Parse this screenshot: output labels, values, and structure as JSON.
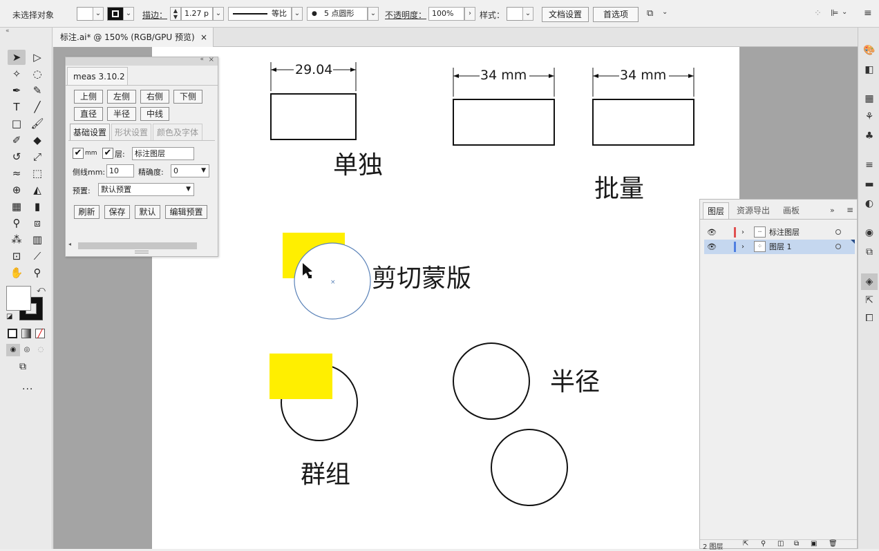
{
  "control_bar": {
    "selection_status": "未选择对象",
    "stroke_label": "描边：",
    "stroke_width": "1.27 p",
    "profile_label": "等比",
    "brush_dot": "●",
    "brush_label": "5 点圆形",
    "opacity_label": "不透明度：",
    "opacity_value": "100%",
    "style_label": "样式：",
    "doc_setup_button": "文档设置",
    "preferences_button": "首选项"
  },
  "document_tab": {
    "title": "标注.ai* @ 150% (RGB/GPU 预览)",
    "close": "×"
  },
  "artboard": {
    "dim_single": "29.04",
    "dim_batch_1": "34 mm",
    "dim_batch_2": "34 mm",
    "label_single": "单独",
    "label_batch": "批量",
    "label_clip": "剪切蒙版",
    "label_radius": "半径",
    "label_group": "群组",
    "highlight_color": "#ffef00"
  },
  "meas_panel": {
    "title": "meas 3.10.2",
    "buttons_row1": [
      "上侧",
      "左侧",
      "右侧",
      "下侧"
    ],
    "buttons_row2": [
      "直径",
      "半径",
      "中线"
    ],
    "tabs": [
      "基础设置",
      "形状设置",
      "颜色及字体"
    ],
    "mm_label": "mm",
    "layer_label": "层:",
    "layer_value": "标注图层",
    "side_line_label": "侧线mm:",
    "side_line_value": "10",
    "precision_label": "精确度:",
    "precision_value": "0",
    "preset_label": "预置:",
    "preset_value": "默认预置",
    "bottom_buttons": [
      "刷新",
      "保存",
      "默认",
      "编辑预置"
    ],
    "check": "✔"
  },
  "layers_panel": {
    "tabs": [
      "图层",
      "资源导出",
      "画板"
    ],
    "layers": [
      {
        "name": "标注图层",
        "color": "#e05050"
      },
      {
        "name": "图层 1",
        "color": "#4f7ee0"
      }
    ],
    "footer": "2 图层"
  }
}
